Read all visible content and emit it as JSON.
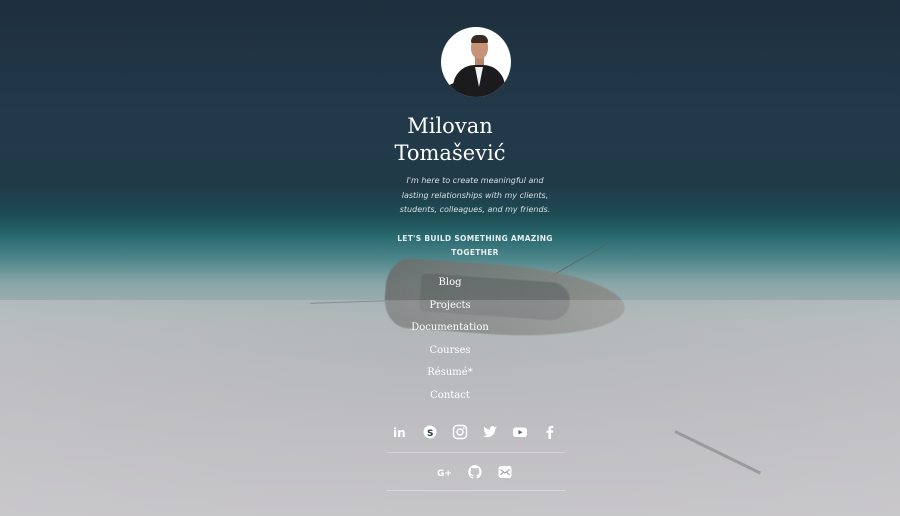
{
  "profile": {
    "name_line1": "Milovan",
    "name_line2": "Tomašević",
    "tagline": "I'm here to create meaningful and lasting relationships with my clients, students, colleagues, and my friends.",
    "cta": "LET'S BUILD SOMETHING AMAZING TOGETHER"
  },
  "nav": {
    "items": [
      {
        "label": "Blog"
      },
      {
        "label": "Projects"
      },
      {
        "label": "Documentation"
      },
      {
        "label": "Courses"
      },
      {
        "label": "Résumé*"
      },
      {
        "label": "Contact"
      }
    ]
  },
  "social": {
    "row1": [
      "linkedin-icon",
      "skype-icon",
      "instagram-icon",
      "twitter-icon",
      "youtube-icon",
      "facebook-icon"
    ],
    "row2": [
      "google-plus-icon",
      "github-icon",
      "email-icon"
    ]
  },
  "colors": {
    "text": "#ffffff",
    "sky_dark": "#1e2f3d",
    "teal": "#2a6b71",
    "sand": "#bcbcbf"
  }
}
